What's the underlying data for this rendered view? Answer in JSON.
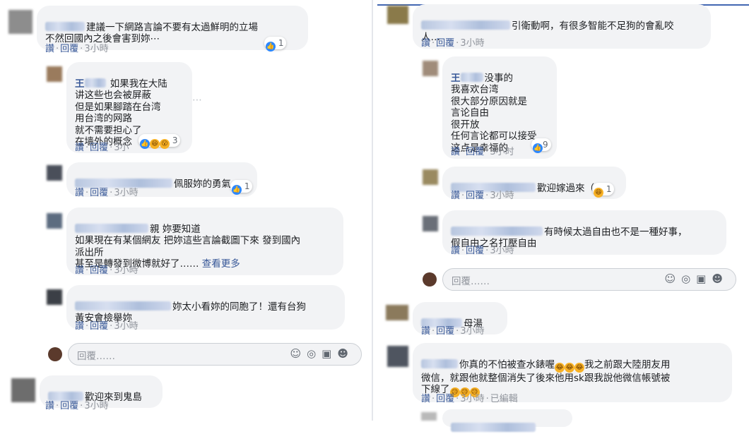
{
  "actions": {
    "like": "讚",
    "reply": "回覆",
    "dot": "·"
  },
  "left": {
    "c1": {
      "text": "建議一下網路言論不要有太過鮮明的立場\n不然回國內之後會害到妳⋯",
      "time": "3小時",
      "react_count": "1"
    },
    "c2": {
      "name_tail": "王",
      "text_first": "如果我在大陆",
      "text": "讲这些也会被屏蔽\n但是如果腳踏在台湾\n用台湾的网路\n就不需要担心了\n在墙外的概念",
      "time": "3小",
      "react_count": "3"
    },
    "c3": {
      "text": "佩服妳的勇氣",
      "time": "3小時",
      "react_count": "1"
    },
    "c4": {
      "text_first": "親 妳要知道",
      "text": "如果現在有某個網友 把妳這些言論截圖下來 發到國內\n派出所\n甚至是轉發到微博就好了……",
      "more": "查看更多",
      "time": "3小時"
    },
    "c5": {
      "text_first": "妳太小看妳的同胞了！還有台狗",
      "text": "黃安會檢舉妳",
      "time": "3小時"
    },
    "reply": {
      "placeholder": "回覆……"
    },
    "c6": {
      "text": "歡迎來到鬼島",
      "time": "3小時"
    }
  },
  "right": {
    "c1": {
      "text_first": "引衛動啊，有很多智能不足狗的會亂咬",
      "text": "人…",
      "time": "3小時"
    },
    "c2": {
      "name_tail": "王",
      "text_first": "没事的",
      "text": "我喜欢台湾\n很大部分原因就是\n言论自由\n很开放\n任何言论都可以接受\n这点是幸福的",
      "time": "3小时",
      "react_count": "9"
    },
    "c3": {
      "text": "歡迎嫁過來（？",
      "time": "3小時",
      "react_count": "1"
    },
    "c4": {
      "text_first": "有時候太過自由也不是一種好事，",
      "text": "假自由之名打壓自由",
      "time": "3小時"
    },
    "reply": {
      "placeholder": "回覆……"
    },
    "c5": {
      "text": "母湯",
      "time": "3小時"
    },
    "c6": {
      "text_first": "你真的不怕被查水錶喔",
      "text_mid": "我之前跟大陸朋友用",
      "text": "微信，就跟他就整個消失了後來他用sk跟我說他微信帳號被\n下線了",
      "time": "3小時",
      "edited": "已編輯"
    }
  },
  "icons": [
    "like-icon",
    "haha-icon",
    "wow-icon",
    "sad-icon",
    "emoji-icon",
    "camera-icon",
    "gif-icon",
    "sticker-icon",
    "more-icon"
  ]
}
